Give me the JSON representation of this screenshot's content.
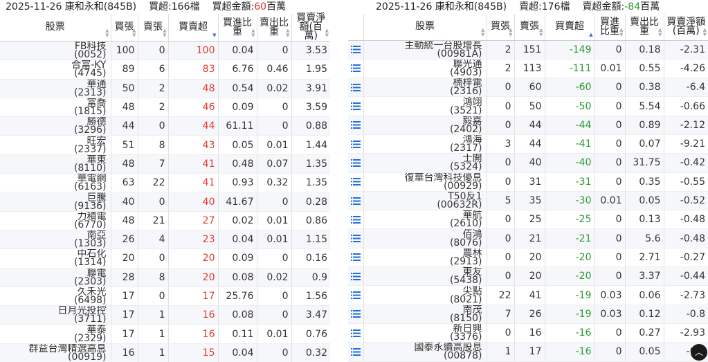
{
  "left": {
    "caption": {
      "date_broker": "2025-11-26 康和永和(845B)",
      "count_label": "買超:166檔",
      "amount_prefix": "買超金額:",
      "amount_value": "60",
      "amount_unit": "百萬"
    },
    "headers": {
      "stock": "股票",
      "buy": "買張",
      "sell": "賣張",
      "net": "買賣超",
      "buy_ratio": "買進比重",
      "sell_ratio": "賣出比重",
      "amount": "買賣淨額(百萬)"
    },
    "rows": [
      {
        "name": "FB科技",
        "code": "(0052)",
        "buy": "100",
        "sell": "0",
        "net": "100",
        "buy_ratio": "0.04",
        "sell_ratio": "0",
        "amount": "3.53"
      },
      {
        "name": "合富-KY",
        "code": "(4745)",
        "buy": "89",
        "sell": "6",
        "net": "83",
        "buy_ratio": "6.76",
        "sell_ratio": "0.46",
        "amount": "1.95"
      },
      {
        "name": "華通",
        "code": "(2313)",
        "buy": "50",
        "sell": "2",
        "net": "48",
        "buy_ratio": "0.54",
        "sell_ratio": "0.02",
        "amount": "3.91"
      },
      {
        "name": "富喬",
        "code": "(1815)",
        "buy": "48",
        "sell": "2",
        "net": "46",
        "buy_ratio": "0.09",
        "sell_ratio": "0",
        "amount": "3.59"
      },
      {
        "name": "勝德",
        "code": "(3296)",
        "buy": "44",
        "sell": "0",
        "net": "44",
        "buy_ratio": "61.11",
        "sell_ratio": "0",
        "amount": "0.88"
      },
      {
        "name": "旺宏",
        "code": "(2337)",
        "buy": "51",
        "sell": "8",
        "net": "43",
        "buy_ratio": "0.05",
        "sell_ratio": "0.01",
        "amount": "1.44"
      },
      {
        "name": "華東",
        "code": "(8110)",
        "buy": "48",
        "sell": "7",
        "net": "41",
        "buy_ratio": "0.48",
        "sell_ratio": "0.07",
        "amount": "1.35"
      },
      {
        "name": "華電網",
        "code": "(6163)",
        "buy": "63",
        "sell": "22",
        "net": "41",
        "buy_ratio": "0.93",
        "sell_ratio": "0.32",
        "amount": "1.35"
      },
      {
        "name": "巨騰",
        "code": "(9136)",
        "buy": "40",
        "sell": "0",
        "net": "40",
        "buy_ratio": "41.67",
        "sell_ratio": "0",
        "amount": "0.28"
      },
      {
        "name": "力積電",
        "code": "(6770)",
        "buy": "48",
        "sell": "21",
        "net": "27",
        "buy_ratio": "0.02",
        "sell_ratio": "0.01",
        "amount": "0.86"
      },
      {
        "name": "南亞",
        "code": "(1303)",
        "buy": "26",
        "sell": "4",
        "net": "23",
        "buy_ratio": "0.04",
        "sell_ratio": "0.01",
        "amount": "1.15"
      },
      {
        "name": "中石化",
        "code": "(1314)",
        "buy": "20",
        "sell": "0",
        "net": "20",
        "buy_ratio": "0.09",
        "sell_ratio": "0",
        "amount": "0.16"
      },
      {
        "name": "聯電",
        "code": "(2303)",
        "buy": "28",
        "sell": "8",
        "net": "20",
        "buy_ratio": "0.08",
        "sell_ratio": "0.02",
        "amount": "0.9"
      },
      {
        "name": "久禾光",
        "code": "(6498)",
        "buy": "17",
        "sell": "0",
        "net": "17",
        "buy_ratio": "25.76",
        "sell_ratio": "0",
        "amount": "1.56"
      },
      {
        "name": "日月光投控",
        "code": "(3711)",
        "buy": "17",
        "sell": "1",
        "net": "16",
        "buy_ratio": "0.08",
        "sell_ratio": "0",
        "amount": "3.47"
      },
      {
        "name": "華泰",
        "code": "(2329)",
        "buy": "17",
        "sell": "1",
        "net": "16",
        "buy_ratio": "0.11",
        "sell_ratio": "0.01",
        "amount": "0.76"
      },
      {
        "name": "群益台灣精選高息",
        "code": "(00919)",
        "buy": "16",
        "sell": "1",
        "net": "15",
        "buy_ratio": "0.04",
        "sell_ratio": "0",
        "amount": "0.32"
      }
    ]
  },
  "right": {
    "caption": {
      "date_broker": "2025-11-26 康和永和(845B)",
      "count_label": "賣超:176檔",
      "amount_prefix": "賣超金額:",
      "amount_value": "-84",
      "amount_unit": "百萬"
    },
    "headers": {
      "stock": "股票",
      "buy": "買張",
      "sell": "賣張",
      "net": "買賣超",
      "buy_ratio": "買進比重",
      "sell_ratio": "賣出比重",
      "amount": "買賣淨額(百萬)"
    },
    "rows": [
      {
        "name": "主動統一台股增長",
        "code": "(00981A)",
        "buy": "2",
        "sell": "151",
        "net": "-149",
        "buy_ratio": "0",
        "sell_ratio": "0.18",
        "amount": "-2.31"
      },
      {
        "name": "聯光通",
        "code": "(4903)",
        "buy": "2",
        "sell": "113",
        "net": "-111",
        "buy_ratio": "0.01",
        "sell_ratio": "0.55",
        "amount": "-4.26"
      },
      {
        "name": "楠梓電",
        "code": "(2316)",
        "buy": "0",
        "sell": "60",
        "net": "-60",
        "buy_ratio": "0",
        "sell_ratio": "0.38",
        "amount": "-6.4"
      },
      {
        "name": "鴻翊",
        "code": "(3521)",
        "buy": "0",
        "sell": "50",
        "net": "-50",
        "buy_ratio": "0",
        "sell_ratio": "5.54",
        "amount": "-0.66"
      },
      {
        "name": "毅嘉",
        "code": "(2402)",
        "buy": "0",
        "sell": "44",
        "net": "-44",
        "buy_ratio": "0",
        "sell_ratio": "0.89",
        "amount": "-2.12"
      },
      {
        "name": "鴻海",
        "code": "(2317)",
        "buy": "3",
        "sell": "44",
        "net": "-41",
        "buy_ratio": "0",
        "sell_ratio": "0.07",
        "amount": "-9.21"
      },
      {
        "name": "士開",
        "code": "(5324)",
        "buy": "0",
        "sell": "40",
        "net": "-40",
        "buy_ratio": "0",
        "sell_ratio": "31.75",
        "amount": "-0.42"
      },
      {
        "name": "復華台灣科技優息",
        "code": "(00929)",
        "buy": "0",
        "sell": "31",
        "net": "-31",
        "buy_ratio": "0",
        "sell_ratio": "0.35",
        "amount": "-0.55"
      },
      {
        "name": "T50反1",
        "code": "(00632R)",
        "buy": "5",
        "sell": "35",
        "net": "-30",
        "buy_ratio": "0.01",
        "sell_ratio": "0.05",
        "amount": "-0.52"
      },
      {
        "name": "華航",
        "code": "(2610)",
        "buy": "0",
        "sell": "25",
        "net": "-25",
        "buy_ratio": "0",
        "sell_ratio": "0.13",
        "amount": "-0.48"
      },
      {
        "name": "佰鴻",
        "code": "(8076)",
        "buy": "0",
        "sell": "21",
        "net": "-21",
        "buy_ratio": "0",
        "sell_ratio": "5.6",
        "amount": "-0.48"
      },
      {
        "name": "農林",
        "code": "(2913)",
        "buy": "0",
        "sell": "20",
        "net": "-20",
        "buy_ratio": "0",
        "sell_ratio": "2.71",
        "amount": "-0.27"
      },
      {
        "name": "東友",
        "code": "(5438)",
        "buy": "0",
        "sell": "20",
        "net": "-20",
        "buy_ratio": "0",
        "sell_ratio": "3.37",
        "amount": "-0.44"
      },
      {
        "name": "尖點",
        "code": "(8021)",
        "buy": "22",
        "sell": "41",
        "net": "-19",
        "buy_ratio": "0.03",
        "sell_ratio": "0.06",
        "amount": "-2.73"
      },
      {
        "name": "南茂",
        "code": "(8150)",
        "buy": "7",
        "sell": "26",
        "net": "-19",
        "buy_ratio": "0.03",
        "sell_ratio": "0.12",
        "amount": "-0.8"
      },
      {
        "name": "新日興",
        "code": "(3376)",
        "buy": "0",
        "sell": "16",
        "net": "-16",
        "buy_ratio": "0",
        "sell_ratio": "0.27",
        "amount": "-2.93"
      },
      {
        "name": "國泰永續高股息",
        "code": "(00878)",
        "buy": "1",
        "sell": "17",
        "net": "-16",
        "buy_ratio": "0",
        "sell_ratio": "0.05",
        "amount": "-0.4"
      }
    ]
  },
  "colors": {
    "positive": "#e23b2f",
    "negative": "#2a9a2e",
    "list_icon": "#1e6fd9",
    "sort_active": "#3a6fd6"
  },
  "icons": {
    "row_detail": "list-icon",
    "scroll_top": "chevron-up-icon",
    "sort": "sort-arrows-icon"
  }
}
